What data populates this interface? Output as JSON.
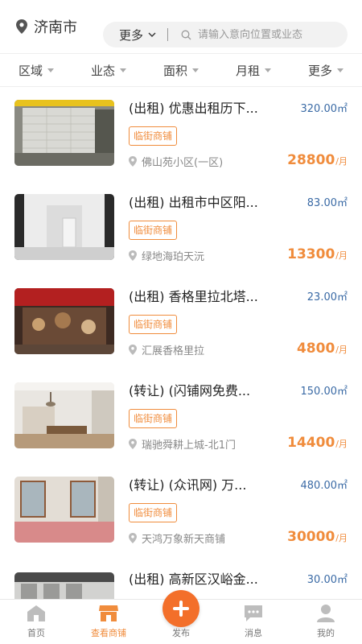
{
  "header": {
    "city": "济南市",
    "more_label": "更多",
    "search_placeholder": "请输入意向位置或业态"
  },
  "filters": [
    "区域",
    "业态",
    "面积",
    "月租",
    "更多"
  ],
  "listings": [
    {
      "title": "(出租) 优惠出租历下...",
      "area": "320.00㎡",
      "tag": "临街商铺",
      "address": "佛山苑小区(一区)",
      "price": "28800",
      "unit": "/月"
    },
    {
      "title": "(出租) 出租市中区阳...",
      "area": "83.00㎡",
      "tag": "临街商铺",
      "address": "绿地海珀天沅",
      "price": "13300",
      "unit": "/月"
    },
    {
      "title": "(出租) 香格里拉北塔...",
      "area": "23.00㎡",
      "tag": "临街商铺",
      "address": "汇展香格里拉",
      "price": "4800",
      "unit": "/月"
    },
    {
      "title": "(转让) (闪铺网免费...",
      "area": "150.00㎡",
      "tag": "临街商铺",
      "address": "瑞驰舜耕上城-北1门",
      "price": "14400",
      "unit": "/月"
    },
    {
      "title": "(转让) (众讯网) 万...",
      "area": "480.00㎡",
      "tag": "临街商铺",
      "address": "天鸿万象新天商铺",
      "price": "30000",
      "unit": "/月"
    },
    {
      "title": "(出租) 高新区汉峪金...",
      "area": "30.00㎡",
      "tag": "",
      "address": "",
      "price": "",
      "unit": ""
    }
  ],
  "nav": {
    "items": [
      {
        "label": "首页",
        "icon": "home-icon"
      },
      {
        "label": "查看商铺",
        "icon": "shop-icon"
      },
      {
        "label": "发布",
        "icon": "plus-icon"
      },
      {
        "label": "消息",
        "icon": "message-icon"
      },
      {
        "label": "我的",
        "icon": "profile-icon"
      }
    ]
  },
  "colors": {
    "accent": "#f08c3c",
    "area_blue": "#3a6aa5",
    "publish": "#f36f2a"
  }
}
